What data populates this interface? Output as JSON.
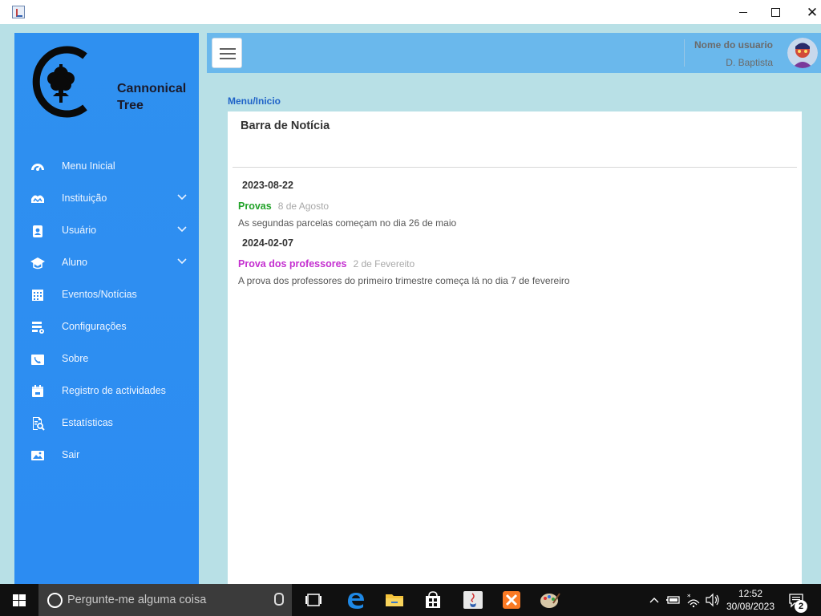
{
  "brand": {
    "line1": "Cannonical",
    "line2": "Tree"
  },
  "sidebar": {
    "items": [
      {
        "label": "Menu Inicial",
        "icon": "dashboard-gauge-icon",
        "expandable": false
      },
      {
        "label": "Instituição",
        "icon": "institution-icon",
        "expandable": true
      },
      {
        "label": "Usuário",
        "icon": "user-badge-icon",
        "expandable": true
      },
      {
        "label": "Aluno",
        "icon": "graduation-cap-icon",
        "expandable": true
      },
      {
        "label": "Eventos/Notícias",
        "icon": "calendar-grid-icon",
        "expandable": false
      },
      {
        "label": "Configurações",
        "icon": "settings-list-icon",
        "expandable": false
      },
      {
        "label": "Sobre",
        "icon": "phone-icon",
        "expandable": false
      },
      {
        "label": "Registro de actividades",
        "icon": "calendar-log-icon",
        "expandable": false
      },
      {
        "label": "Estatísticas",
        "icon": "report-search-icon",
        "expandable": false
      },
      {
        "label": "Sair",
        "icon": "image-exit-icon",
        "expandable": false
      }
    ]
  },
  "header": {
    "user_title": "Nome do usuario",
    "user_name": "D. Baptista"
  },
  "breadcrumb": "Menu/Inicio",
  "card": {
    "title": "Barra de Notícia",
    "news": [
      {
        "date": "2023-08-22",
        "tag": "Provas",
        "tag_color": "#22a329",
        "subdate": "8 de Agosto",
        "text": "As segundas parcelas começam no dia 26 de maio"
      },
      {
        "date": "2024-02-07",
        "tag": "Prova dos professores",
        "tag_color": "#c42fd0",
        "subdate": "2 de Fevereito",
        "text": "A prova dos professores do primeiro trimestre começa lá no dia 7 de fevereiro"
      }
    ]
  },
  "taskbar": {
    "search_placeholder": "Pergunte-me alguma coisa",
    "time": "12:52",
    "date": "30/08/2023",
    "notification_count": "2"
  },
  "colors": {
    "sidebar": "#2c8cf2",
    "header": "#6ab8ec",
    "background": "#b8e0e6",
    "breadcrumb": "#1f63c8"
  }
}
